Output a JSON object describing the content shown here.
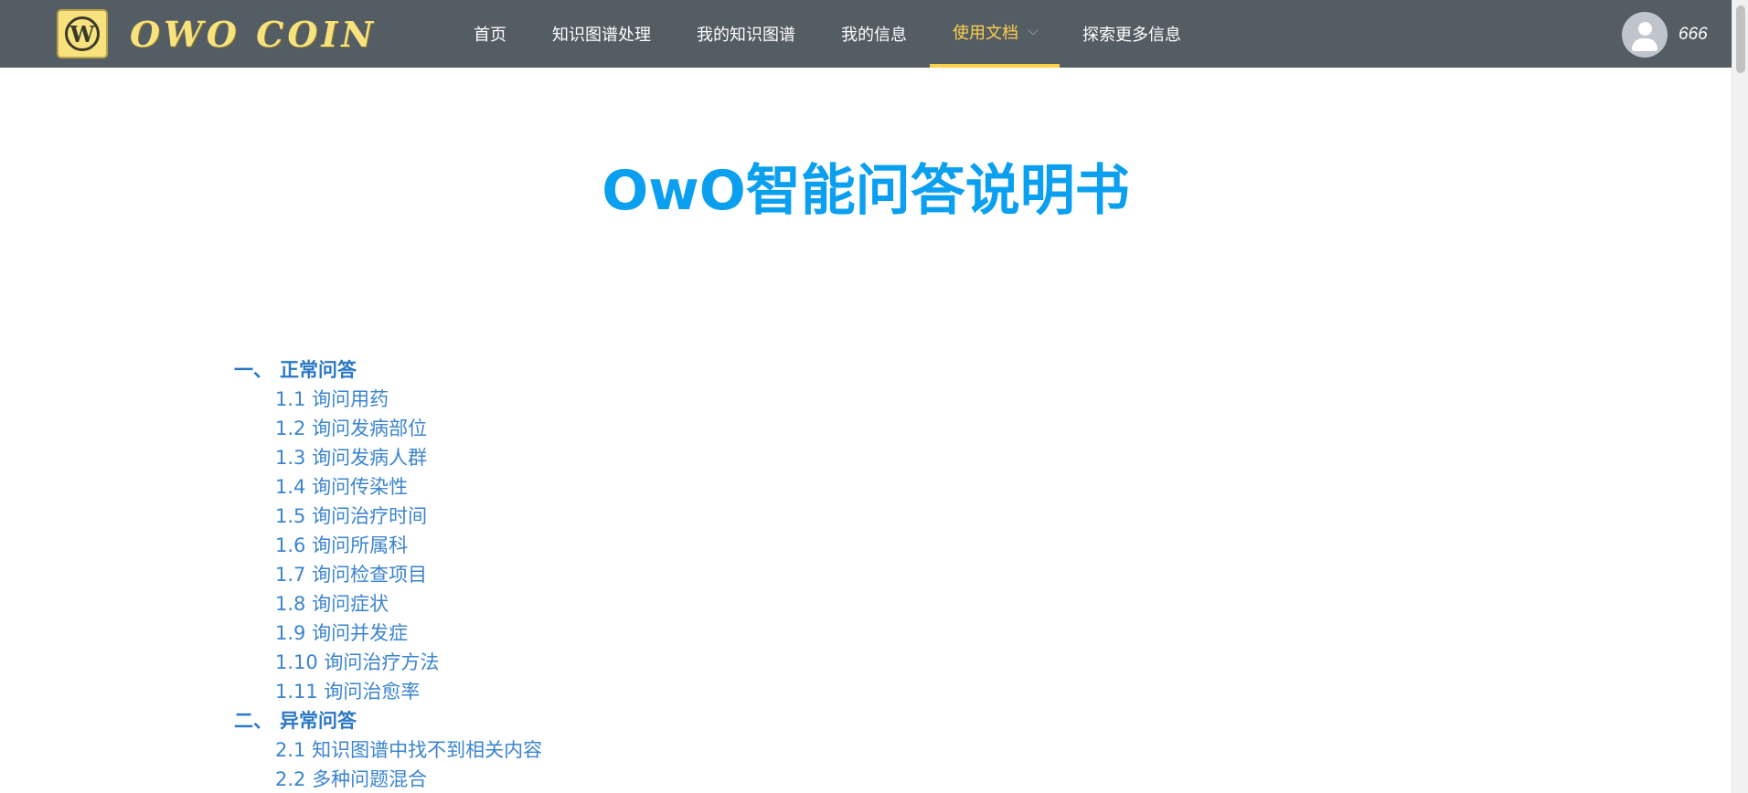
{
  "header": {
    "logo_letter": "W",
    "logo_text": "OWO COIN",
    "nav": [
      {
        "label": "首页"
      },
      {
        "label": "知识图谱处理"
      },
      {
        "label": "我的知识图谱"
      },
      {
        "label": "我的信息"
      },
      {
        "label": "使用文档",
        "active": true,
        "has_dropdown": true
      },
      {
        "label": "探索更多信息"
      }
    ],
    "username": "666"
  },
  "main": {
    "title": "OwO智能问答说明书",
    "toc": [
      {
        "number": "一、",
        "title": "正常问答",
        "items": [
          {
            "label": "1.1 询问用药"
          },
          {
            "label": "1.2 询问发病部位"
          },
          {
            "label": "1.3 询问发病人群"
          },
          {
            "label": "1.4 询问传染性"
          },
          {
            "label": "1.5 询问治疗时间"
          },
          {
            "label": "1.6 询问所属科"
          },
          {
            "label": "1.7 询问检查项目"
          },
          {
            "label": "1.8 询问症状"
          },
          {
            "label": "1.9 询问并发症"
          },
          {
            "label": "1.10 询问治疗方法"
          },
          {
            "label": "1.11 询问治愈率"
          }
        ]
      },
      {
        "number": "二、",
        "title": "异常问答",
        "items": [
          {
            "label": "2.1 知识图谱中找不到相关内容"
          },
          {
            "label": "2.2 多种问题混合"
          }
        ]
      }
    ]
  },
  "colors": {
    "navbar_bg": "#545c64",
    "nav_active": "#ffd04b",
    "title": "#0b9ff0",
    "toc_section": "#2a78c6",
    "toc_item": "#3b84cf",
    "logo": "#f7e27e"
  },
  "icons": {
    "logo": "coin-w-logo",
    "avatar": "user-silhouette-icon",
    "dropdown": "chevron-down-icon"
  }
}
